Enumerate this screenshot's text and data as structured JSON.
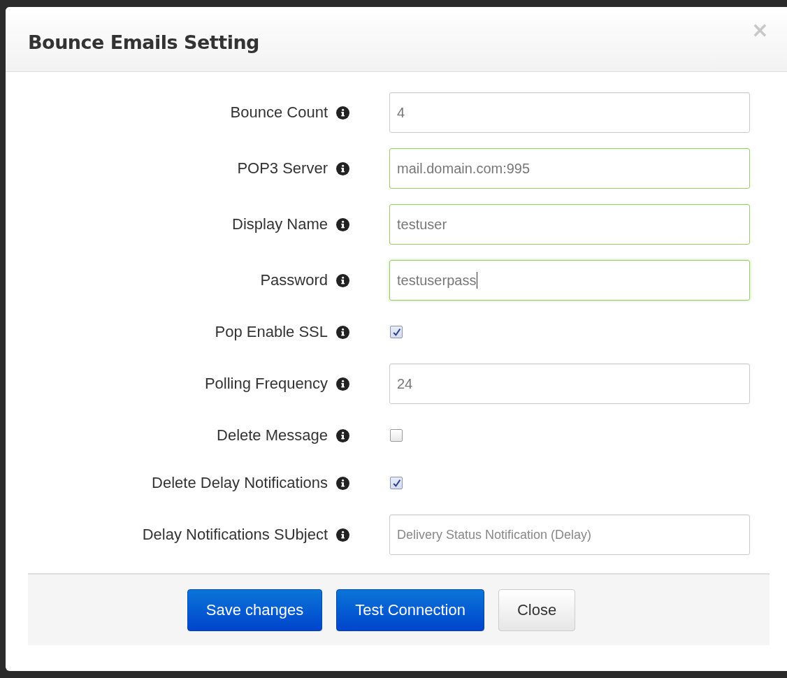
{
  "dialog": {
    "title": "Bounce Emails Setting",
    "close": "×"
  },
  "fields": [
    {
      "kind": "text",
      "label": "Bounce Count",
      "value": "4",
      "validated": false,
      "focused": false
    },
    {
      "kind": "text",
      "label": "POP3 Server",
      "value": "mail.domain.com:995",
      "validated": true,
      "focused": false
    },
    {
      "kind": "text",
      "label": "Display Name",
      "value": "testuser",
      "validated": true,
      "focused": false
    },
    {
      "kind": "text",
      "label": "Password",
      "value": "testuserpass",
      "validated": true,
      "focused": true
    },
    {
      "kind": "checkbox",
      "label": "Pop Enable SSL",
      "checked": true
    },
    {
      "kind": "text",
      "label": "Polling Frequency",
      "value": "24",
      "validated": false,
      "focused": false
    },
    {
      "kind": "checkbox",
      "label": "Delete Message",
      "checked": false
    },
    {
      "kind": "checkbox",
      "label": "Delete Delay Notifications",
      "checked": true
    },
    {
      "kind": "text",
      "label": "Delay Notifications SUbject",
      "placeholder": "Delivery Status Notification (Delay)",
      "validated": false,
      "focused": false
    }
  ],
  "buttons": [
    {
      "label": "Save changes",
      "kind": "primary"
    },
    {
      "label": "Test Connection",
      "kind": "primary"
    },
    {
      "label": "Close",
      "kind": "default"
    }
  ]
}
